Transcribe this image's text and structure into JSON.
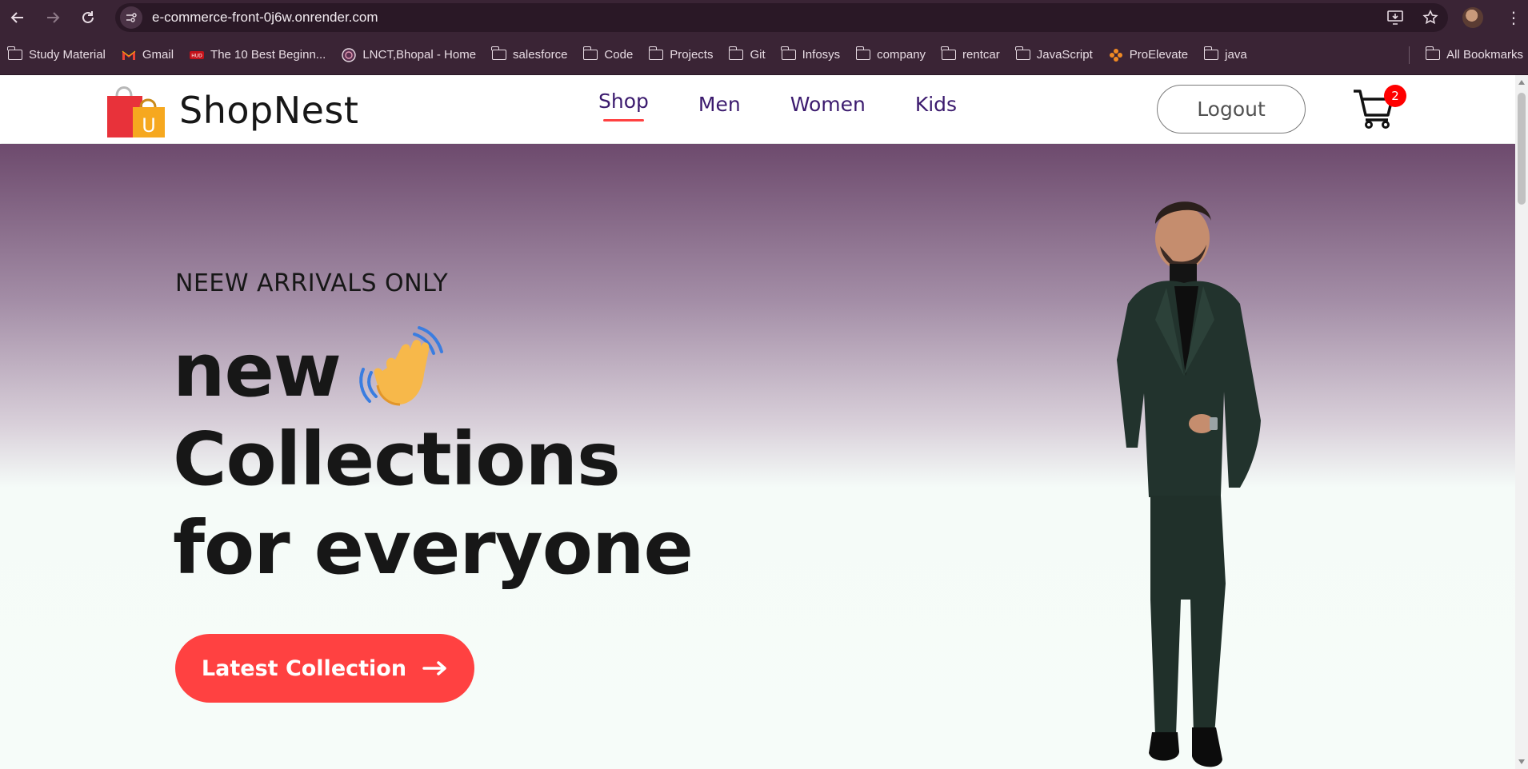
{
  "browser": {
    "url": "e-commerce-front-0j6w.onrender.com",
    "bookmarks": [
      {
        "label": "Study Material",
        "icon": "folder-icon"
      },
      {
        "label": "Gmail",
        "icon": "gmail-icon"
      },
      {
        "label": "The 10 Best Beginn...",
        "icon": "site-icon"
      },
      {
        "label": "LNCT,Bhopal - Home",
        "icon": "lnct-icon"
      },
      {
        "label": "salesforce",
        "icon": "folder-icon"
      },
      {
        "label": "Code",
        "icon": "folder-icon"
      },
      {
        "label": "Projects",
        "icon": "folder-icon"
      },
      {
        "label": "Git",
        "icon": "folder-icon"
      },
      {
        "label": "Infosys",
        "icon": "folder-icon"
      },
      {
        "label": "company",
        "icon": "folder-icon"
      },
      {
        "label": "rentcar",
        "icon": "folder-icon"
      },
      {
        "label": "JavaScript",
        "icon": "folder-icon"
      },
      {
        "label": "ProElevate",
        "icon": "proelevate-icon"
      },
      {
        "label": "java",
        "icon": "folder-icon"
      }
    ],
    "all_bookmarks": "All Bookmarks"
  },
  "site": {
    "brand": "ShopNest",
    "logo_letter": "U",
    "nav": [
      {
        "label": "Shop",
        "active": true
      },
      {
        "label": "Men",
        "active": false
      },
      {
        "label": "Women",
        "active": false
      },
      {
        "label": "Kids",
        "active": false
      }
    ],
    "logout_label": "Logout",
    "cart_count": "2"
  },
  "hero": {
    "eyebrow": "NEEW ARRIVALS ONLY",
    "line1": "new",
    "line2": "Collections",
    "line3": "for everyone",
    "cta_label": "Latest Collection"
  },
  "colors": {
    "accent": "#ff4141",
    "nav_text": "#3b1a6e",
    "chrome_bg": "#3a2435"
  }
}
